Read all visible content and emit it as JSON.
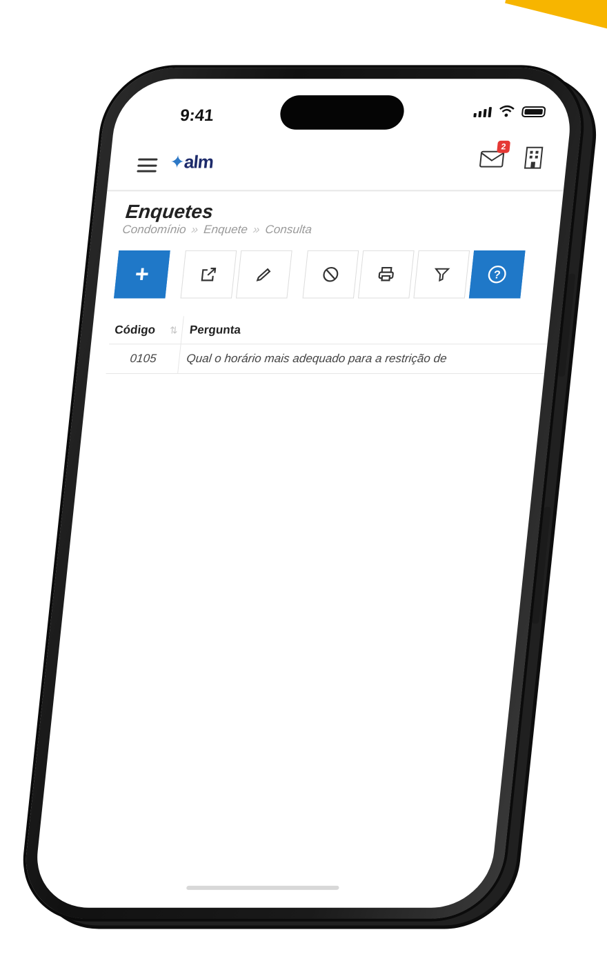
{
  "status_bar": {
    "time": "9:41"
  },
  "header": {
    "logo_prefix": "✦",
    "logo_text": "alm",
    "mail_icon": "mail-icon",
    "mail_badge": "2",
    "building_icon": "building-icon",
    "menu_icon": "hamburger-icon"
  },
  "page": {
    "title": "Enquetes",
    "breadcrumb": [
      "Condomínio",
      "Enquete",
      "Consulta"
    ],
    "breadcrumb_separator": "»"
  },
  "toolbar": {
    "buttons": [
      {
        "name": "add",
        "icon": "plus-icon",
        "glyph": "+"
      },
      {
        "name": "open",
        "icon": "external-link-icon",
        "glyph": "↗"
      },
      {
        "name": "edit",
        "icon": "pencil-icon",
        "glyph": "✎"
      },
      {
        "name": "cancel",
        "icon": "ban-icon",
        "glyph": "⊘"
      },
      {
        "name": "print",
        "icon": "printer-icon",
        "glyph": "⎙"
      },
      {
        "name": "filter",
        "icon": "filter-icon",
        "glyph": "▽"
      },
      {
        "name": "help",
        "icon": "help-icon",
        "glyph": "?"
      }
    ]
  },
  "table": {
    "columns": [
      "Código",
      "Pergunta"
    ],
    "sort_indicator": "⇅",
    "rows": [
      {
        "codigo": "0105",
        "pergunta": "Qual o horário mais adequado para a restrição de"
      }
    ]
  },
  "colors": {
    "primary": "#1f78c8",
    "accent": "#f7b500",
    "badge": "#e53935"
  }
}
